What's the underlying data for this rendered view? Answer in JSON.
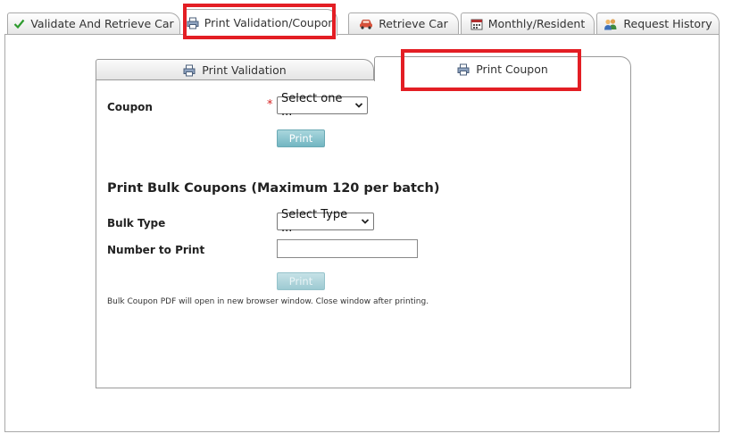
{
  "top_tabs": [
    {
      "label": "Validate And Retrieve Car",
      "icon": "checkmark-icon",
      "active": false
    },
    {
      "label": "Print Validation/Coupon",
      "icon": "printer-icon",
      "active": true
    },
    {
      "label": "Retrieve Car",
      "icon": "car-icon",
      "active": false
    },
    {
      "label": "Monthly/Resident",
      "icon": "calendar-icon",
      "active": false
    },
    {
      "label": "Request History",
      "icon": "users-icon",
      "active": false
    }
  ],
  "inner_tabs": [
    {
      "label": "Print Validation",
      "icon": "printer-icon",
      "active": false
    },
    {
      "label": "Print Coupon",
      "icon": "printer-icon",
      "active": true
    }
  ],
  "coupon_form": {
    "coupon_label": "Coupon",
    "required_marker": "*",
    "coupon_select_value": "Select one ...",
    "print_label": "Print"
  },
  "bulk_form": {
    "title": "Print Bulk Coupons (Maximum 120 per batch)",
    "bulk_type_label": "Bulk Type",
    "bulk_type_select_value": "Select Type ...",
    "number_label": "Number to Print",
    "number_value": "",
    "print_label": "Print",
    "note": "Bulk Coupon PDF will open in new browser window. Close window after printing."
  },
  "colors": {
    "highlight": "#e31e24",
    "button": "#72b6c2",
    "required": "#d62222",
    "check_green": "#2e9b2e"
  }
}
